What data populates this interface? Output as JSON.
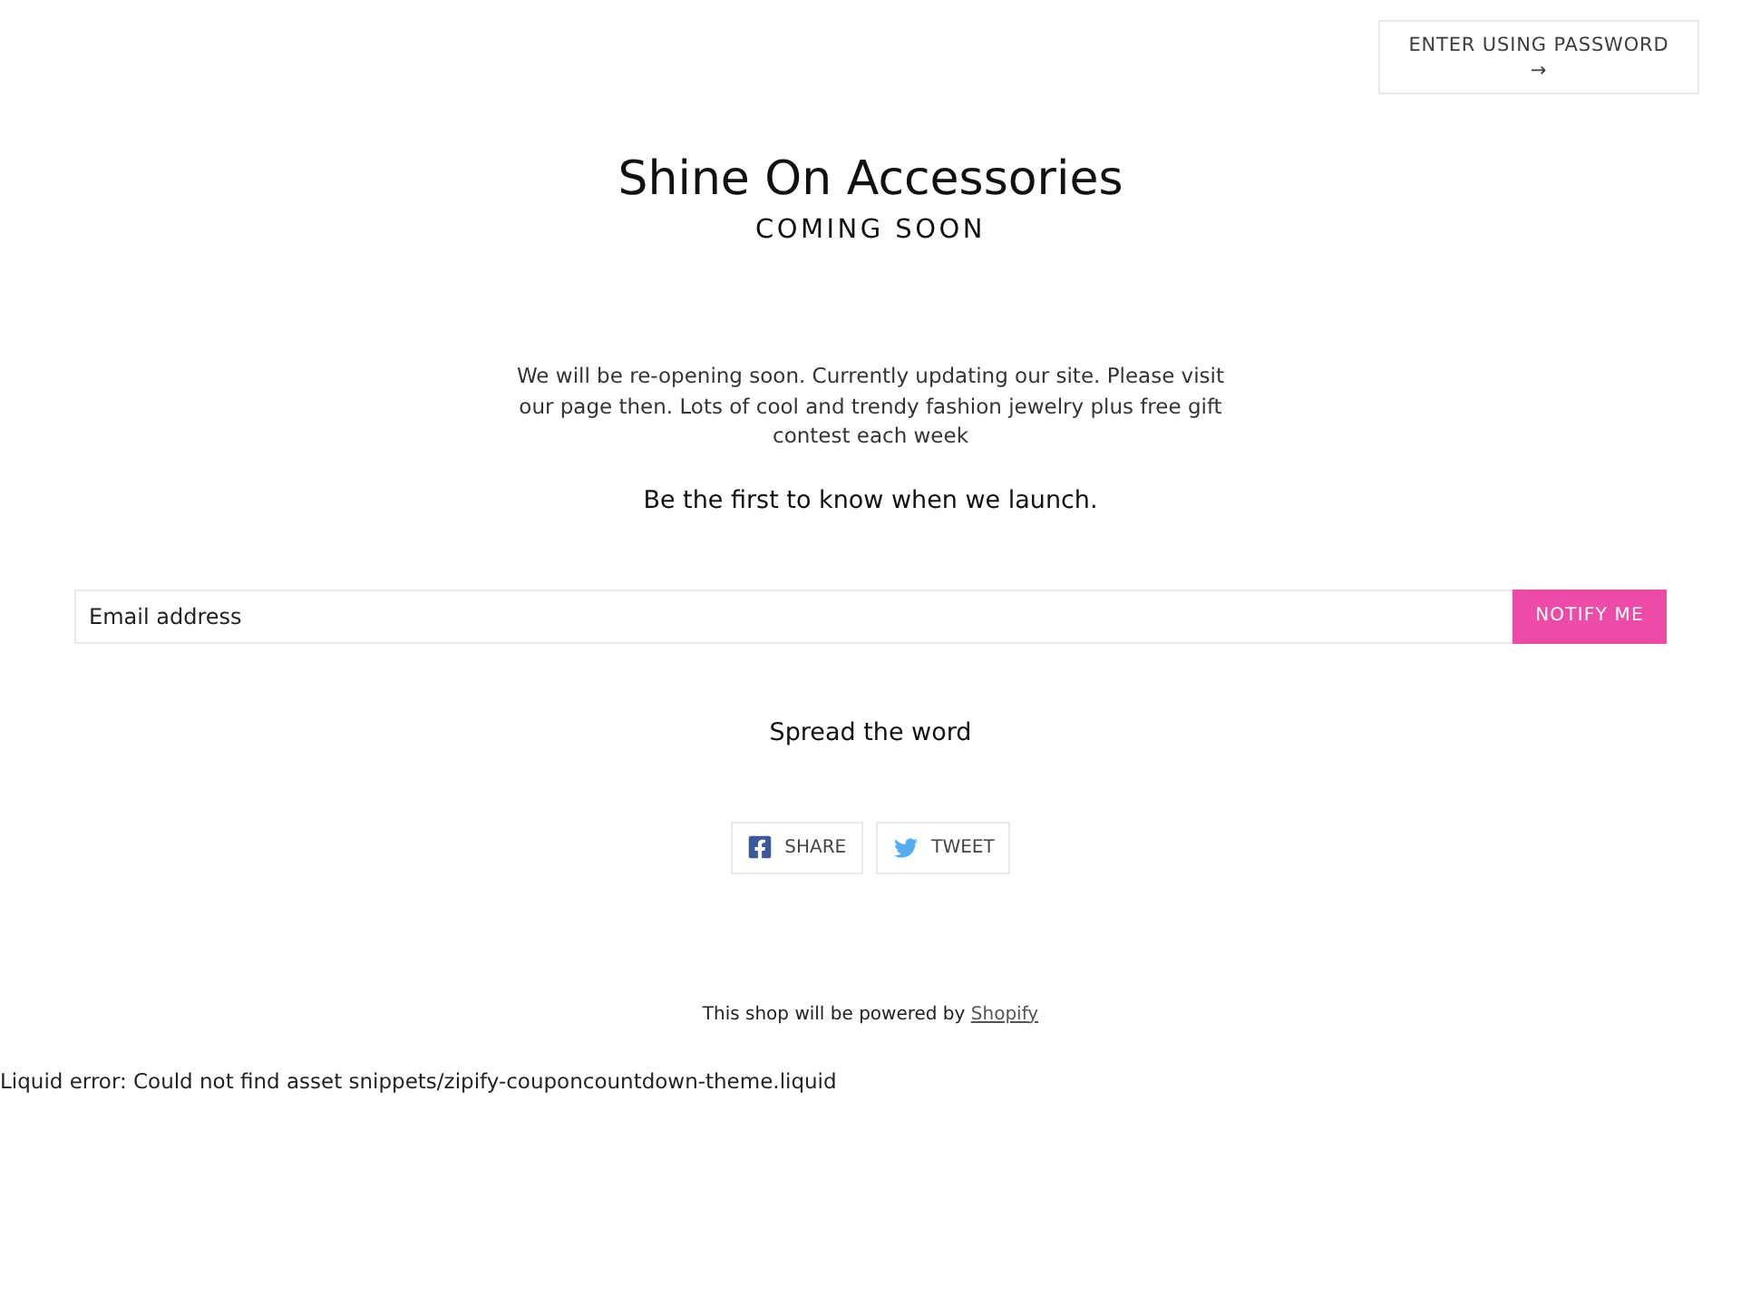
{
  "header": {
    "password_button": {
      "label": "ENTER USING PASSWORD",
      "arrow": "→"
    }
  },
  "hero": {
    "title": "Shine On Accessories",
    "subtitle": "COMING SOON",
    "message": "We will be re-opening soon. Currently updating our site. Please visit our page then. Lots of cool and trendy fashion jewelry plus free gift contest each week",
    "signup_heading": "Be the first to know when we launch."
  },
  "signup_form": {
    "email": {
      "placeholder": "Email address"
    },
    "submit": "NOTIFY ME"
  },
  "share": {
    "heading": "Spread the word",
    "buttons": [
      {
        "kind": "facebook",
        "label": "SHARE"
      },
      {
        "kind": "twitter",
        "label": "TWEET"
      }
    ]
  },
  "footer": {
    "text": "This shop will be powered by",
    "link": "Shopify"
  },
  "error_message": "Liquid error: Could not find asset snippets/zipify-couponcountdown-theme.liquid"
}
